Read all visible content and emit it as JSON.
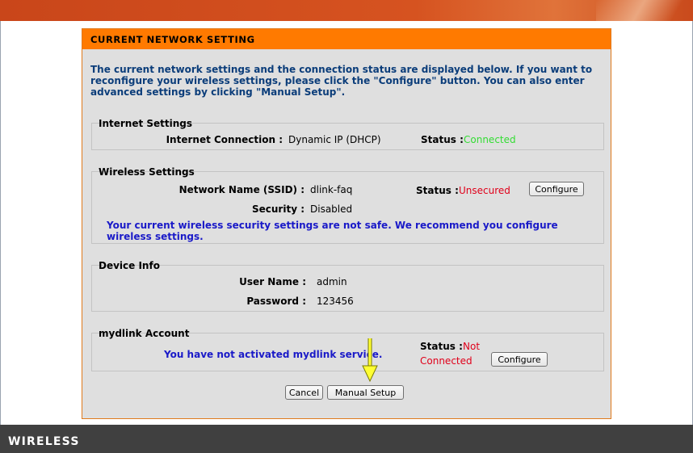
{
  "panel": {
    "title": "CURRENT NETWORK SETTING",
    "intro": "The current network settings and the connection status are displayed below. If you want to reconfigure your wireless settings, please click the \"Configure\" button. You can also enter advanced settings by clicking \"Manual Setup\"."
  },
  "internet": {
    "section_title": "Internet Settings",
    "connection_label": "Internet Connection :",
    "connection_value": "Dynamic IP (DHCP)",
    "status_label": "Status :",
    "status_value": "Connected"
  },
  "wireless": {
    "section_title": "Wireless Settings",
    "ssid_label": "Network Name (SSID) :",
    "ssid_value": "dlink-faq",
    "status_label": "Status :",
    "status_value": "Unsecured",
    "configure_label": "Configure",
    "security_label": "Security :",
    "security_value": "Disabled",
    "warning": "Your current wireless security settings are not safe. We recommend you configure wireless settings."
  },
  "device": {
    "section_title": "Device Info",
    "user_label": "User Name :",
    "user_value": "admin",
    "password_label": "Password :",
    "password_value": "123456"
  },
  "mydlink": {
    "section_title": "mydlink Account",
    "message": "You have not activated mydlink service.",
    "status_label": "Status :",
    "status_value_line1": "Not",
    "status_value_line2": "Connected",
    "configure_label": "Configure"
  },
  "actions": {
    "cancel_label": "Cancel",
    "manual_setup_label": "Manual Setup"
  },
  "footer": {
    "brand": "WIRELESS"
  },
  "colors": {
    "header_orange": "#ff7a00",
    "connected_green": "#33dd33",
    "unsecured_red": "#e0001a",
    "warning_blue": "#1a1ac8"
  }
}
